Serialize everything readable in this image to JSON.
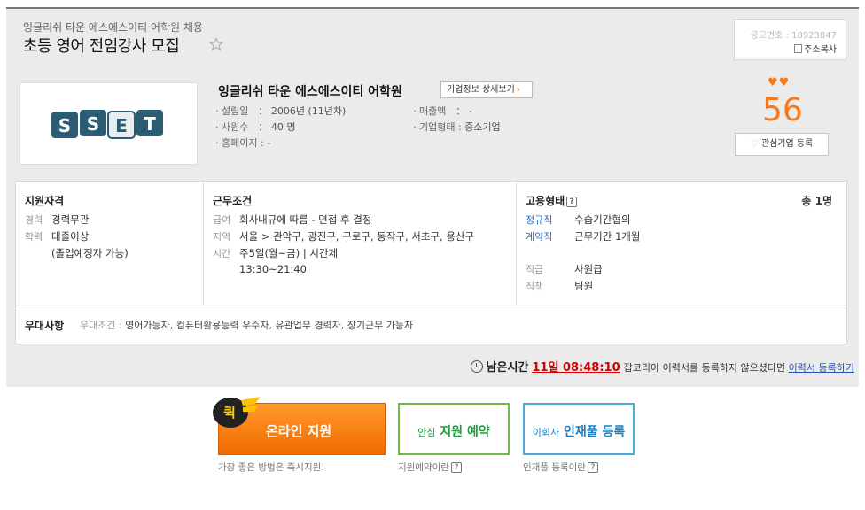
{
  "header": {
    "company_sub": "잉글리쉬 타운 에스에스이티 어학원 채용",
    "job_title": "초등 영어 전임강사 모집",
    "notice_no": "공고번호 : 18923847",
    "copy_address": "주소복사"
  },
  "company": {
    "logo_text": "SSET",
    "logo_letters": [
      "S",
      "S",
      "E",
      "T"
    ],
    "name": "잉글리쉬 타운 에스에스이티 어학원",
    "detail_button": "기업정보 상세보기",
    "fields": [
      {
        "label": "· 설립일　：",
        "value": "2006년 (11년차)"
      },
      {
        "label": "· 사원수　：",
        "value": "40 명"
      },
      {
        "label": "· 홈페이지 :",
        "value": "-"
      },
      {
        "label": "· 매출액　：",
        "value": "-"
      },
      {
        "label": "· 기업형태 :",
        "value": "중소기업"
      }
    ],
    "score": "56",
    "favorite_button": "관심기업 등록"
  },
  "requirements": {
    "qualification": {
      "title": "지원자격",
      "rows": [
        {
          "key": "경력",
          "value": "경력무관"
        },
        {
          "key": "학력",
          "value": "대졸이상"
        },
        {
          "key": "",
          "value": "(졸업예정자 가능)"
        }
      ]
    },
    "conditions": {
      "title": "근무조건",
      "rows": [
        {
          "key": "급여",
          "value": "회사내규에 따름 - 면접 후 결정"
        },
        {
          "key": "지역",
          "value": "서울 > 관악구, 광진구, 구로구, 동작구, 서초구, 용산구"
        },
        {
          "key": "시간",
          "value": "주5일(월~금) | 시간제"
        },
        {
          "key": "",
          "value": "13:30~21:40"
        }
      ]
    },
    "employment": {
      "title": "고용형태",
      "total": "총 1명",
      "rows": [
        {
          "key": "정규직",
          "value": "수습기간협의"
        },
        {
          "key": "계약직",
          "value": "근무기간 1개월"
        },
        {
          "key": "직급",
          "value": "사원급"
        },
        {
          "key": "직책",
          "value": "팀원"
        }
      ]
    }
  },
  "preference": {
    "title": "우대사항",
    "key": "우대조건 :",
    "value": "영어가능자, 컴퓨터활용능력 우수자, 유관업무 경력자, 장기근무 가능자"
  },
  "deadline": {
    "label": "남은시간",
    "value": "11일 08:48:10",
    "message": "잡코리아 이력서를 등록하지 않으셨다면",
    "link": "이력서 등록하기"
  },
  "actions": {
    "quick_badge": "퀵",
    "apply": "온라인 지원",
    "apply_caption": "가장 좋은 방법은 즉시지원!",
    "reserve_prefix": "안심",
    "reserve": "지원 예약",
    "reserve_caption": "지원예약이란",
    "pool_prefix": "이회사",
    "pool": "인재풀 등록",
    "pool_caption": "인재풀 등록이란"
  },
  "colors": {
    "accent_orange": "#f47a20",
    "deadline_red": "#d50000",
    "link_blue": "#2355b4",
    "logo_teal": "#2a5d73"
  }
}
